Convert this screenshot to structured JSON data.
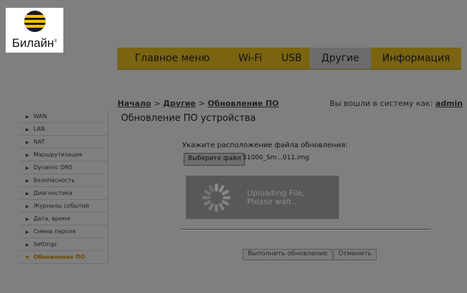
{
  "brand": {
    "name": "Билайн",
    "reg": "®"
  },
  "nav": {
    "tabs": [
      {
        "label": "Главное меню",
        "active": false
      },
      {
        "label": "Wi-Fi",
        "active": false
      },
      {
        "label": "USB",
        "active": false
      },
      {
        "label": "Другие",
        "active": true
      },
      {
        "label": "Информация",
        "active": false
      }
    ]
  },
  "breadcrumb": {
    "home": "Начало",
    "sep": ">",
    "other": "Другие",
    "current": "Обновление ПО"
  },
  "login": {
    "label": "Вы вошли в систему как:",
    "user": "admin"
  },
  "page_title": "Обновление ПО устройства",
  "sidebar": {
    "items": [
      {
        "label": "WAN"
      },
      {
        "label": "LAN"
      },
      {
        "label": "NAT"
      },
      {
        "label": "Маршрутизация"
      },
      {
        "label": "Dynamic DNS"
      },
      {
        "label": "Безопасность"
      },
      {
        "label": "Диагностика"
      },
      {
        "label": "Журналы событий"
      },
      {
        "label": "Дата, время"
      },
      {
        "label": "Смена пароля"
      },
      {
        "label": "Settings"
      },
      {
        "label": "Обновление ПО",
        "active": true
      }
    ]
  },
  "upload": {
    "prompt": "Укажите расположение файла обновления:",
    "choose_label": "Выберите файл",
    "file_name": "S1000_Sm...011.img",
    "status_line1": "Uploading File,",
    "status_line2": "Please wait..."
  },
  "actions": {
    "apply_label": "Выполнить обновление",
    "cancel_label": "Отменить"
  },
  "colors": {
    "accent": "#f5c400",
    "overlay": "#7f7f7f"
  }
}
